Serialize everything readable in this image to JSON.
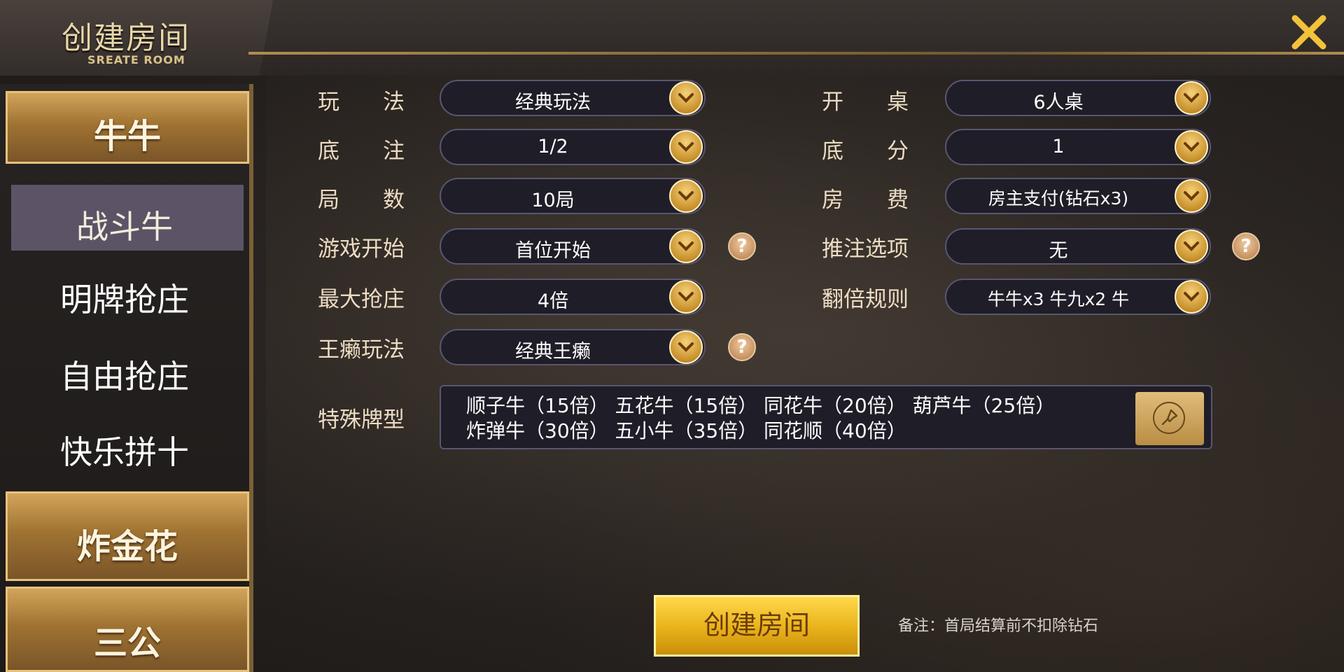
{
  "header": {
    "title": "创建房间",
    "subtitle": "SREATE ROOM",
    "close_icon": "close-icon"
  },
  "sidebar": {
    "categories": [
      {
        "label": "牛牛"
      },
      {
        "label": "炸金花"
      },
      {
        "label": "三公"
      }
    ],
    "subitems": [
      {
        "label": "战斗牛",
        "active": true
      },
      {
        "label": "明牌抢庄"
      },
      {
        "label": "自由抢庄"
      },
      {
        "label": "快乐拼十"
      }
    ]
  },
  "form": {
    "play_mode": {
      "label": "玩　　法",
      "value": "经典玩法"
    },
    "base_bet": {
      "label": "底　　注",
      "value": "1/2"
    },
    "rounds": {
      "label": "局　　数",
      "value": "10局"
    },
    "game_start": {
      "label": "游戏开始",
      "value": "首位开始"
    },
    "max_banker": {
      "label": "最大抢庄",
      "value": "4倍"
    },
    "wild_play": {
      "label": "王癞玩法",
      "value": "经典王癞"
    },
    "table": {
      "label": "开　　桌",
      "value": "6人桌"
    },
    "base_score": {
      "label": "底　　分",
      "value": "1"
    },
    "room_fee": {
      "label": "房　　费",
      "value": "房主支付(钻石x3)"
    },
    "push_bet": {
      "label": "推注选项",
      "value": "无"
    },
    "double_rule": {
      "label": "翻倍规则",
      "value": "牛牛x3 牛九x2 牛"
    },
    "special": {
      "label": "特殊牌型",
      "line1": "顺子牛（15倍） 五花牛（15倍） 同花牛（20倍） 葫芦牛（25倍）",
      "line2": "炸弹牛（30倍） 五小牛（35倍） 同花顺（40倍）"
    },
    "help_text": "?"
  },
  "footer": {
    "create_label": "创建房间",
    "note": "备注：首局结算前不扣除钻石"
  },
  "colors": {
    "gold_accent": "#e8b11a",
    "label_text": "#ecdcc3",
    "select_bg": "#1f1d27",
    "active_sub_bg": "#5c5466"
  }
}
